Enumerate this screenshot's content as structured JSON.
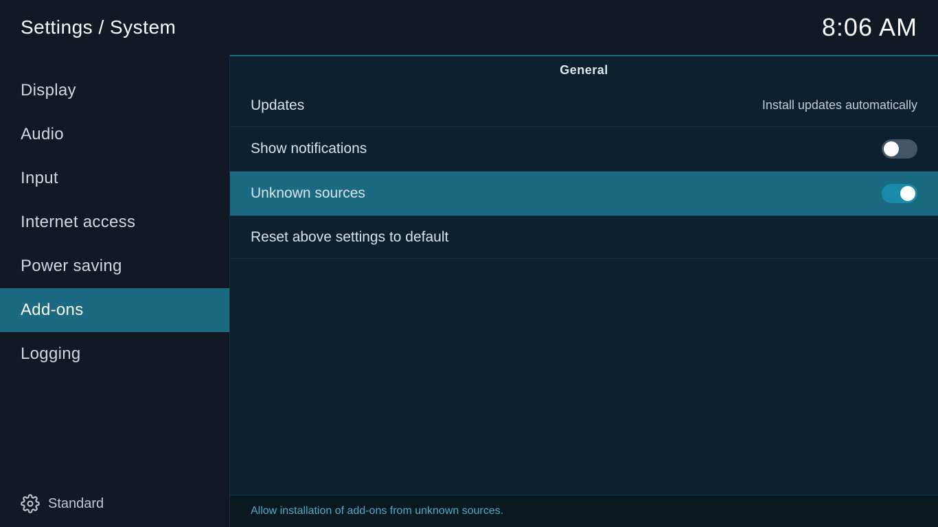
{
  "header": {
    "title": "Settings / System",
    "time": "8:06 AM"
  },
  "sidebar": {
    "items": [
      {
        "id": "display",
        "label": "Display",
        "active": false
      },
      {
        "id": "audio",
        "label": "Audio",
        "active": false
      },
      {
        "id": "input",
        "label": "Input",
        "active": false
      },
      {
        "id": "internet-access",
        "label": "Internet access",
        "active": false
      },
      {
        "id": "power-saving",
        "label": "Power saving",
        "active": false
      },
      {
        "id": "add-ons",
        "label": "Add-ons",
        "active": true
      },
      {
        "id": "logging",
        "label": "Logging",
        "active": false
      }
    ],
    "footer_label": "Standard"
  },
  "content": {
    "section_title": "General",
    "settings": [
      {
        "id": "updates",
        "label": "Updates",
        "value": "Install updates automatically",
        "toggle": null,
        "selected": false
      },
      {
        "id": "show-notifications",
        "label": "Show notifications",
        "value": null,
        "toggle": "off",
        "selected": false
      },
      {
        "id": "unknown-sources",
        "label": "Unknown sources",
        "value": null,
        "toggle": "on",
        "selected": true
      },
      {
        "id": "reset-settings",
        "label": "Reset above settings to default",
        "value": null,
        "toggle": null,
        "selected": false
      }
    ],
    "footer_hint": "Allow installation of add-ons from unknown sources."
  }
}
